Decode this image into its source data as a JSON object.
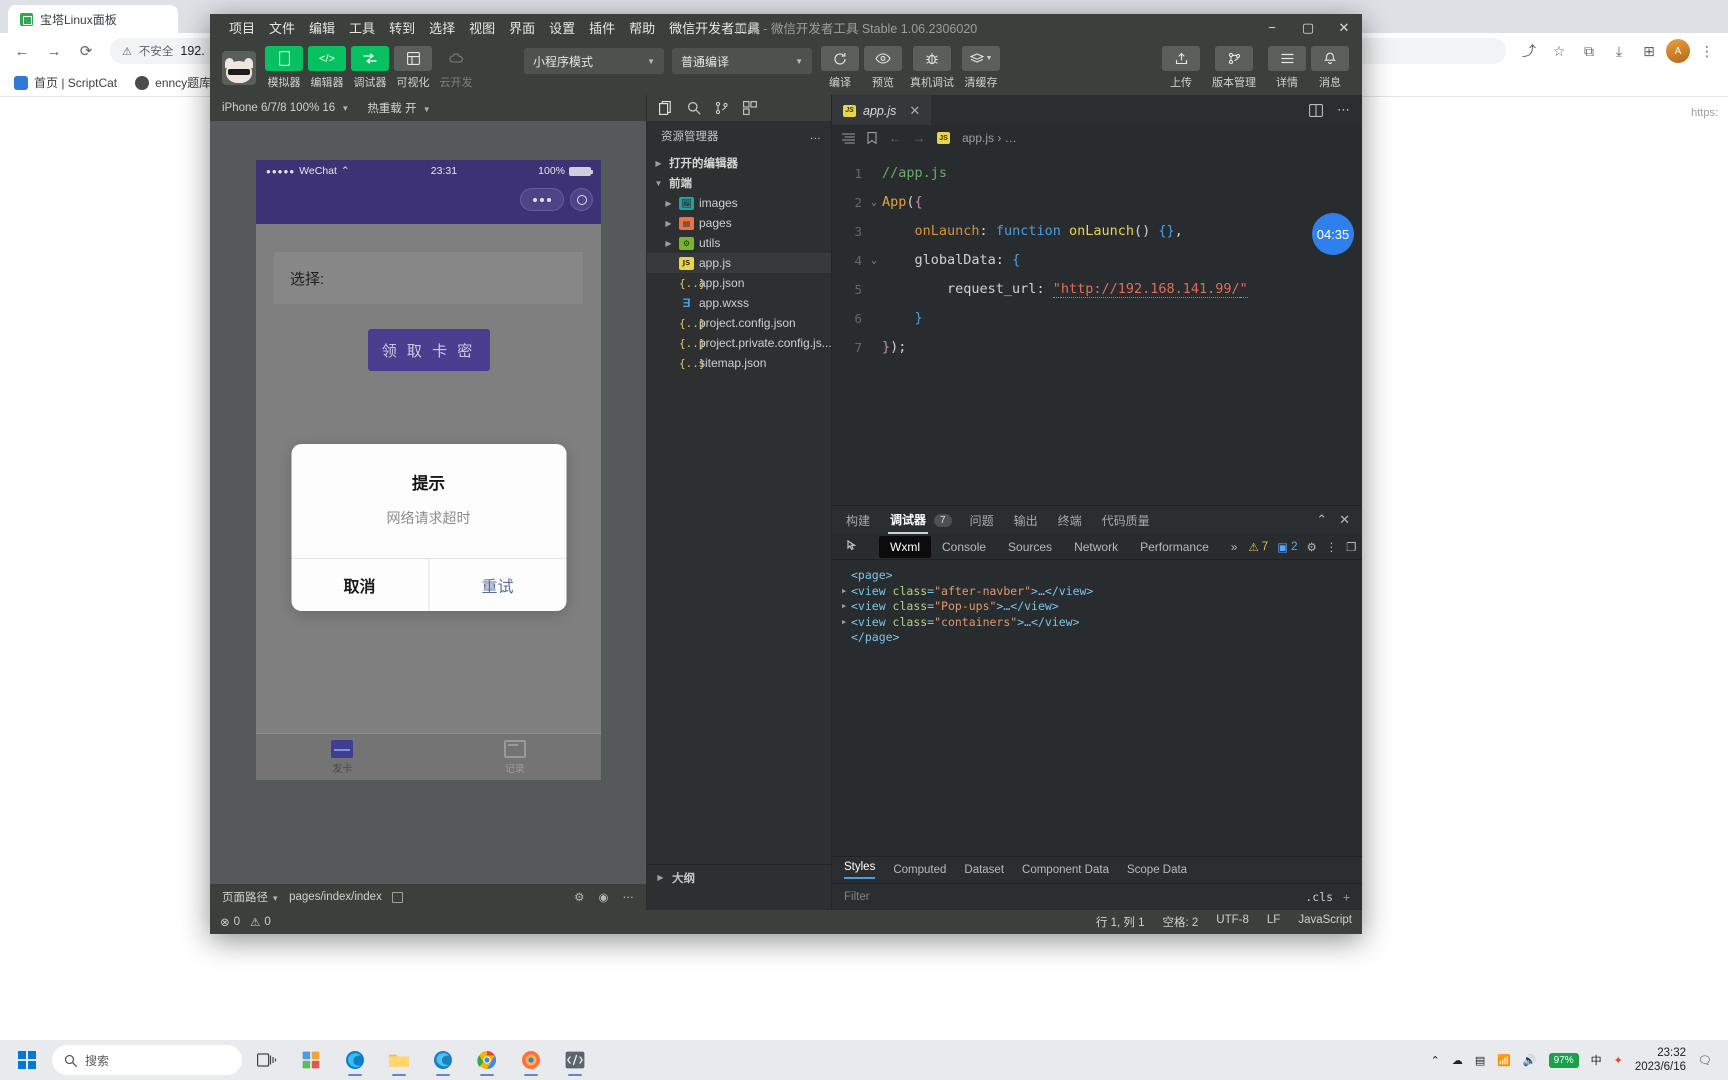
{
  "browser": {
    "tab_title": "宝塔Linux面板",
    "nav": {
      "back": "←",
      "forward": "→",
      "reload": "⟳"
    },
    "omnibox": {
      "security_label": "不安全",
      "url": "192.",
      "warn_icon": "warning-triangle-icon"
    },
    "bookmarks": [
      {
        "label": "首页 | ScriptCat",
        "color": "#2f7ad6"
      },
      {
        "label": "enncy题库",
        "color": "#4b4b4b"
      }
    ],
    "page_right_text": "https:"
  },
  "ide": {
    "menu": [
      "项目",
      "文件",
      "编辑",
      "工具",
      "转到",
      "选择",
      "视图",
      "界面",
      "设置",
      "插件",
      "帮助",
      "微信开发者工具"
    ],
    "window_title": "前端 - 微信开发者工具 Stable 1.06.2306020",
    "window_controls": {
      "minimize": "−",
      "maximize": "▢",
      "close": "✕"
    },
    "toolbar": {
      "left_buttons": [
        {
          "label": "模拟器",
          "icon": "simulator-icon",
          "style": "green",
          "glyph": "▯"
        },
        {
          "label": "编辑器",
          "icon": "editor-icon",
          "style": "green",
          "glyph": "</>"
        },
        {
          "label": "调试器",
          "icon": "debugger-icon",
          "style": "green",
          "glyph": "⇄"
        },
        {
          "label": "可视化",
          "icon": "visual-icon",
          "style": "grey",
          "glyph": "⊞"
        },
        {
          "label": "云开发",
          "icon": "cloud-icon",
          "style": "none",
          "glyph": "☁",
          "dim": true
        }
      ],
      "mode_select": "小程序模式",
      "compile_select": "普通编译",
      "mid_buttons": [
        {
          "label": "编译",
          "icon": "refresh-icon",
          "glyph": "⟳"
        },
        {
          "label": "预览",
          "icon": "eye-icon",
          "glyph": "◉"
        },
        {
          "label": "真机调试",
          "icon": "bug-icon",
          "glyph": "✹"
        },
        {
          "label": "清缓存",
          "icon": "layers-icon",
          "glyph": "≋"
        }
      ],
      "right_buttons": [
        {
          "label": "上传",
          "icon": "upload-icon",
          "glyph": "⇧"
        },
        {
          "label": "版本管理",
          "icon": "branch-icon",
          "glyph": "ᛘ"
        },
        {
          "label": "详情",
          "icon": "details-icon",
          "glyph": "☰"
        },
        {
          "label": "消息",
          "icon": "bell-icon",
          "glyph": "🔔"
        }
      ]
    },
    "simulator": {
      "device_select": "iPhone 6/7/8 100% 16",
      "hot_reload": "热重载 开",
      "phone": {
        "status": {
          "carrier": "WeChat",
          "time": "23:31",
          "battery": "100%"
        },
        "select_label": "选择:",
        "primary_button": "领 取 卡 密",
        "modal": {
          "title": "提示",
          "message": "网络请求超时",
          "cancel": "取消",
          "confirm": "重试"
        },
        "tabbar": [
          {
            "label": "发卡",
            "active": true
          },
          {
            "label": "记录",
            "active": false
          }
        ]
      },
      "footer": {
        "path_label": "页面路径",
        "path_value": "pages/index/index"
      }
    },
    "explorer": {
      "action_icons": [
        "files-icon",
        "search-icon",
        "branch-icon",
        "extensions-icon"
      ],
      "title": "资源管理器",
      "more": "…",
      "sections": [
        {
          "label": "打开的编辑器",
          "expanded": false
        },
        {
          "label": "前端",
          "expanded": true
        }
      ],
      "files": [
        {
          "name": "images",
          "type": "folder",
          "color": "teal",
          "indent": 2
        },
        {
          "name": "pages",
          "type": "folder",
          "color": "orange",
          "indent": 2
        },
        {
          "name": "utils",
          "type": "folder",
          "color": "green",
          "indent": 2
        },
        {
          "name": "app.js",
          "type": "js",
          "indent": 3,
          "selected": true
        },
        {
          "name": "app.json",
          "type": "json",
          "indent": 3
        },
        {
          "name": "app.wxss",
          "type": "wxss",
          "indent": 3
        },
        {
          "name": "project.config.json",
          "type": "json",
          "indent": 3
        },
        {
          "name": "project.private.config.js...",
          "type": "json",
          "indent": 3
        },
        {
          "name": "sitemap.json",
          "type": "json",
          "indent": 3
        }
      ],
      "outline": "大纲"
    },
    "editor": {
      "tab": {
        "label": "app.js",
        "icon": "js-file-icon",
        "close": "✕"
      },
      "tab_right_icons": [
        "split-editor-icon",
        "more-actions-icon"
      ],
      "breadcrumb": {
        "file": "app.js",
        "sep": "›",
        "rest": "…"
      },
      "toolbar_icons": [
        "outline-icon",
        "bookmark-icon",
        "back-arrow-icon",
        "forward-arrow-icon"
      ],
      "timer_badge": "04:35",
      "lines": [
        {
          "no": "1",
          "fold": "",
          "tokens": [
            {
              "t": "//app.js",
              "c": "c-com"
            }
          ]
        },
        {
          "no": "2",
          "fold": "⌄",
          "tokens": [
            {
              "t": "App",
              "c": "c-fn"
            },
            {
              "t": "(",
              "c": "c-pun"
            },
            {
              "t": "{",
              "c": "c-brk"
            }
          ]
        },
        {
          "no": "3",
          "fold": "",
          "tokens": [
            {
              "t": "    ",
              "c": "c-pun"
            },
            {
              "t": "onLaunch",
              "c": "c-key"
            },
            {
              "t": ": ",
              "c": "c-pun"
            },
            {
              "t": "function",
              "c": "c-blue"
            },
            {
              "t": " ",
              "c": "c-pun"
            },
            {
              "t": "onLaunch",
              "c": "c-yel"
            },
            {
              "t": "() ",
              "c": "c-pun"
            },
            {
              "t": "{}",
              "c": "c-blue"
            },
            {
              "t": ",",
              "c": "c-pun"
            }
          ]
        },
        {
          "no": "4",
          "fold": "⌄",
          "tokens": [
            {
              "t": "    ",
              "c": "c-pun"
            },
            {
              "t": "globalData",
              "c": "c-pun"
            },
            {
              "t": ": ",
              "c": "c-pun"
            },
            {
              "t": "{",
              "c": "c-blue"
            }
          ]
        },
        {
          "no": "5",
          "fold": "",
          "tokens": [
            {
              "t": "        ",
              "c": "c-pun"
            },
            {
              "t": "request_url",
              "c": "c-pun"
            },
            {
              "t": ": ",
              "c": "c-pun"
            },
            {
              "t": "\"",
              "c": "c-str"
            },
            {
              "t": "http://192.168.141.99/",
              "c": "c-str"
            },
            {
              "t": "\"",
              "c": "c-str"
            }
          ]
        },
        {
          "no": "6",
          "fold": "",
          "tokens": [
            {
              "t": "    ",
              "c": "c-pun"
            },
            {
              "t": "}",
              "c": "c-blue"
            }
          ]
        },
        {
          "no": "7",
          "fold": "",
          "tokens": [
            {
              "t": "}",
              "c": "c-brk"
            },
            {
              "t": ")",
              "c": "c-pun"
            },
            {
              "t": ";",
              "c": "c-pun"
            }
          ]
        }
      ]
    },
    "devtools": {
      "panel_tabs": [
        {
          "label": "构建",
          "active": false
        },
        {
          "label": "调试器",
          "active": true,
          "badge": "7"
        },
        {
          "label": "问题",
          "active": false
        },
        {
          "label": "输出",
          "active": false
        },
        {
          "label": "终端",
          "active": false
        },
        {
          "label": "代码质量",
          "active": false
        }
      ],
      "panel_controls": [
        "collapse-icon",
        "close-icon"
      ],
      "sub_tabs": [
        {
          "label": "Wxml",
          "active": true
        },
        {
          "label": "Console",
          "active": false
        },
        {
          "label": "Sources",
          "active": false
        },
        {
          "label": "Network",
          "active": false
        },
        {
          "label": "Performance",
          "active": false
        }
      ],
      "overflow": "»",
      "warnings": "7",
      "errors": "2",
      "right_icons": [
        "gear-icon",
        "more-vertical-icon",
        "dock-icon"
      ],
      "dom": [
        {
          "indent": 0,
          "arrow": "",
          "tokens": [
            {
              "t": "<page>",
              "c": "tg"
            }
          ]
        },
        {
          "indent": 0,
          "arrow": "▶",
          "tokens": [
            {
              "t": "<view ",
              "c": "tg"
            },
            {
              "t": "class",
              "c": "at"
            },
            {
              "t": "=",
              "c": "tg"
            },
            {
              "t": "\"after-navber\"",
              "c": "vl"
            },
            {
              "t": ">…</view>",
              "c": "tg"
            }
          ]
        },
        {
          "indent": 0,
          "arrow": "▶",
          "tokens": [
            {
              "t": "<view ",
              "c": "tg"
            },
            {
              "t": "class",
              "c": "at"
            },
            {
              "t": "=",
              "c": "tg"
            },
            {
              "t": "\"Pop-ups\"",
              "c": "vl"
            },
            {
              "t": ">…</view>",
              "c": "tg"
            }
          ]
        },
        {
          "indent": 0,
          "arrow": "▶",
          "tokens": [
            {
              "t": "<view ",
              "c": "tg"
            },
            {
              "t": "class",
              "c": "at"
            },
            {
              "t": "=",
              "c": "tg"
            },
            {
              "t": "\"containers\"",
              "c": "vl"
            },
            {
              "t": ">…</view>",
              "c": "tg"
            }
          ]
        },
        {
          "indent": 0,
          "arrow": "",
          "tokens": [
            {
              "t": "</page>",
              "c": "tg"
            }
          ]
        }
      ],
      "style_tabs": [
        {
          "label": "Styles",
          "active": true
        },
        {
          "label": "Computed",
          "active": false
        },
        {
          "label": "Dataset",
          "active": false
        },
        {
          "label": "Component Data",
          "active": false
        },
        {
          "label": "Scope Data",
          "active": false
        }
      ],
      "filter_placeholder": "Filter",
      "cls_label": ".cls",
      "add_label": "+"
    },
    "status_bar": {
      "errors": "0",
      "warnings": "0",
      "cursor": "行 1, 列 1",
      "spaces": "空格: 2",
      "encoding": "UTF-8",
      "eol": "LF",
      "language": "JavaScript"
    }
  },
  "taskbar": {
    "search_placeholder": "搜索",
    "battery": "97%",
    "clock_time": "23:32",
    "clock_date": "2023/6/16"
  }
}
